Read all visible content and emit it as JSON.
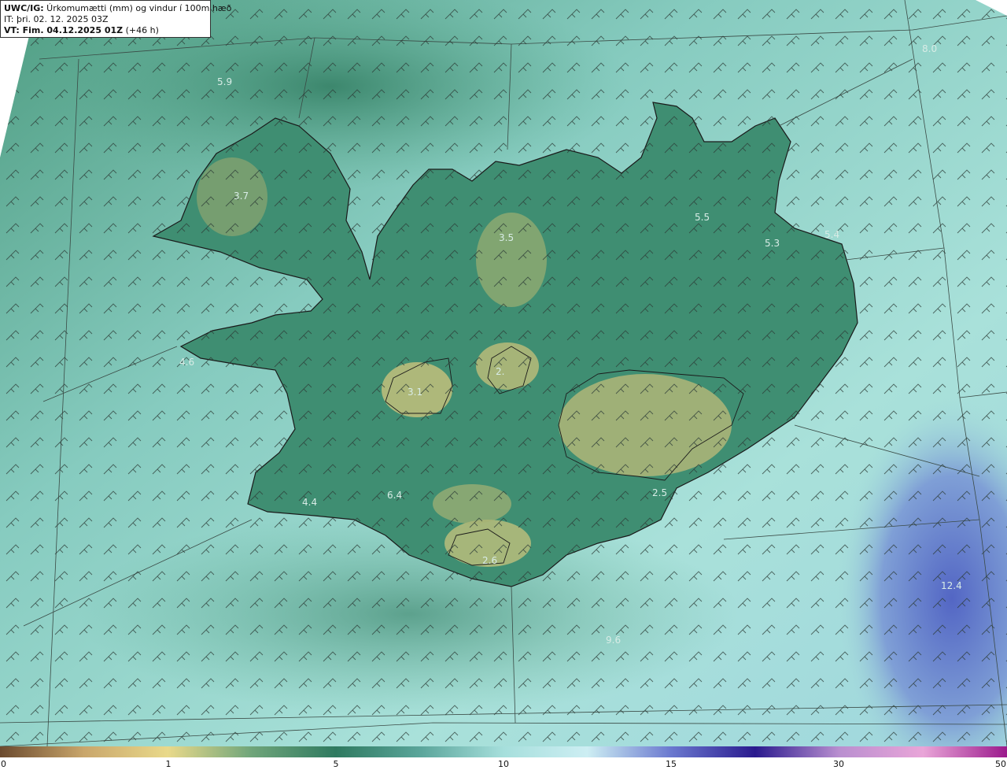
{
  "header": {
    "line1_bold": "UWC/IG:",
    "line1_text": " Úrkomumætti (mm) og vindur í 100m hæð",
    "line2": "IT: þri. 02. 12. 2025 03Z",
    "line3_bold": "VT: Fim. 04.12.2025 01Z",
    "line3_text": " (+46 h)"
  },
  "values": [
    "5.9",
    "8.0",
    "3.7",
    "3.5",
    "5.5",
    "5.3",
    "5.4",
    "4.6",
    "3.1",
    "2.",
    "4.4",
    "6.4",
    "2.5",
    "2.6",
    "12.4",
    "9.6"
  ],
  "colorbar": {
    "ticks": [
      "0",
      "1",
      "5",
      "10",
      "15",
      "30",
      "50"
    ],
    "colors": [
      "#6b4a2e",
      "#c9a66b",
      "#e9d98a",
      "#6fa57a",
      "#2f7a60",
      "#5aa59a",
      "#a6dfdc",
      "#cdeef3",
      "#6a78cf",
      "#2a1a8e",
      "#b98fd0",
      "#e9a5d8",
      "#9b1a8c"
    ]
  },
  "colors": {
    "sea": "#8fd2c9",
    "land_low": "#3c8a6f",
    "land_high": "#c2c27a",
    "heavy_precip": "#5f74c8",
    "coast": "#1a1a1a"
  }
}
